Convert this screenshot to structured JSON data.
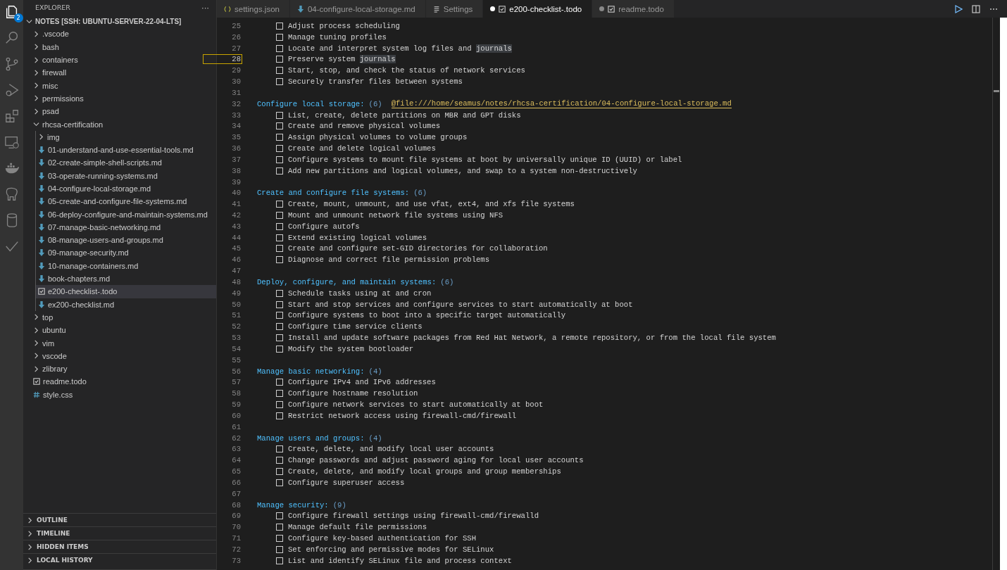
{
  "activity_bar": {
    "badge": "2"
  },
  "explorer": {
    "title": "EXPLORER",
    "more": "···",
    "root": "NOTES [SSH: UBUNTU-SERVER-22-04-LTS]",
    "tree": [
      {
        "name": ".vscode",
        "kind": "folder",
        "expanded": false,
        "selected": false
      },
      {
        "name": "bash",
        "kind": "folder",
        "expanded": false,
        "selected": false
      },
      {
        "name": "containers",
        "kind": "folder",
        "expanded": false,
        "selected": false
      },
      {
        "name": "firewall",
        "kind": "folder",
        "expanded": false,
        "selected": false
      },
      {
        "name": "misc",
        "kind": "folder",
        "expanded": false,
        "selected": false
      },
      {
        "name": "permissions",
        "kind": "folder",
        "expanded": false,
        "selected": false
      },
      {
        "name": "psad",
        "kind": "folder",
        "expanded": false,
        "selected": false
      },
      {
        "name": "rhcsa-certification",
        "kind": "folder",
        "expanded": true,
        "selected": false,
        "children": [
          {
            "name": "img",
            "kind": "folder",
            "expanded": false,
            "selected": false
          },
          {
            "name": "01-understand-and-use-essential-tools.md",
            "kind": "md",
            "selected": false
          },
          {
            "name": "02-create-simple-shell-scripts.md",
            "kind": "md",
            "selected": false
          },
          {
            "name": "03-operate-running-systems.md",
            "kind": "md",
            "selected": false
          },
          {
            "name": "04-configure-local-storage.md",
            "kind": "md",
            "selected": false
          },
          {
            "name": "05-create-and-configure-file-systems.md",
            "kind": "md",
            "selected": false
          },
          {
            "name": "06-deploy-configure-and-maintain-systems.md",
            "kind": "md",
            "selected": false
          },
          {
            "name": "07-manage-basic-networking.md",
            "kind": "md",
            "selected": false
          },
          {
            "name": "08-manage-users-and-groups.md",
            "kind": "md",
            "selected": false
          },
          {
            "name": "09-manage-security.md",
            "kind": "md",
            "selected": false
          },
          {
            "name": "10-manage-containers.md",
            "kind": "md",
            "selected": false
          },
          {
            "name": "book-chapters.md",
            "kind": "md",
            "selected": false
          },
          {
            "name": "e200-checklist-.todo",
            "kind": "todo",
            "selected": true
          },
          {
            "name": "ex200-checklist.md",
            "kind": "md",
            "selected": false
          }
        ]
      },
      {
        "name": "top",
        "kind": "folder",
        "expanded": false,
        "selected": false
      },
      {
        "name": "ubuntu",
        "kind": "folder",
        "expanded": false,
        "selected": false
      },
      {
        "name": "vim",
        "kind": "folder",
        "expanded": false,
        "selected": false
      },
      {
        "name": "vscode",
        "kind": "folder",
        "expanded": false,
        "selected": false
      },
      {
        "name": "zlibrary",
        "kind": "folder",
        "expanded": false,
        "selected": false
      },
      {
        "name": "readme.todo",
        "kind": "todo",
        "selected": false
      },
      {
        "name": "style.css",
        "kind": "css",
        "selected": false
      }
    ],
    "sections": [
      "OUTLINE",
      "TIMELINE",
      "HIDDEN ITEMS",
      "LOCAL HISTORY"
    ]
  },
  "tabs": [
    {
      "label": "settings.json",
      "kind": "json",
      "selected": false,
      "dirty": false
    },
    {
      "label": "04-configure-local-storage.md",
      "kind": "md",
      "selected": false,
      "dirty": false
    },
    {
      "label": "Settings",
      "kind": "settings",
      "selected": false,
      "dirty": false
    },
    {
      "label": "e200-checklist-.todo",
      "kind": "todo",
      "selected": true,
      "dirty": true
    },
    {
      "label": "readme.todo",
      "kind": "todo",
      "selected": false,
      "dirty": true
    }
  ],
  "editor": {
    "lines": [
      {
        "n": "25",
        "kind": "task",
        "current": false,
        "parts": [
          {
            "text": "Adjust process scheduling",
            "highlighted": false
          }
        ]
      },
      {
        "n": "26",
        "kind": "task",
        "current": false,
        "parts": [
          {
            "text": "Manage tuning profiles",
            "highlighted": false
          }
        ]
      },
      {
        "n": "27",
        "kind": "task",
        "current": false,
        "parts": [
          {
            "text": "Locate and interpret system log files and ",
            "highlighted": false
          },
          {
            "text": "journals",
            "highlighted": true
          }
        ]
      },
      {
        "n": "28",
        "kind": "task",
        "current": true,
        "parts": [
          {
            "text": "Preserve system ",
            "highlighted": false
          },
          {
            "text": "journals",
            "highlighted": true
          }
        ]
      },
      {
        "n": "29",
        "kind": "task",
        "current": false,
        "parts": [
          {
            "text": "Start, stop, and check the status of network services",
            "highlighted": false
          }
        ]
      },
      {
        "n": "30",
        "kind": "task",
        "current": false,
        "parts": [
          {
            "text": "Securely transfer files between systems",
            "highlighted": false
          }
        ]
      },
      {
        "n": "31",
        "kind": "blank",
        "current": false
      },
      {
        "n": "32",
        "kind": "header",
        "current": false,
        "title": "Configure local storage:",
        "count": "(6)",
        "link": "@file:///home/seamus/notes/rhcsa-certification/04-configure-local-storage.md"
      },
      {
        "n": "33",
        "kind": "task",
        "current": false,
        "parts": [
          {
            "text": "List, create, delete partitions on MBR and GPT disks",
            "highlighted": false
          }
        ]
      },
      {
        "n": "34",
        "kind": "task",
        "current": false,
        "parts": [
          {
            "text": "Create and remove physical volumes",
            "highlighted": false
          }
        ]
      },
      {
        "n": "35",
        "kind": "task",
        "current": false,
        "parts": [
          {
            "text": "Assign physical volumes to volume groups",
            "highlighted": false
          }
        ]
      },
      {
        "n": "36",
        "kind": "task",
        "current": false,
        "parts": [
          {
            "text": "Create and delete logical volumes",
            "highlighted": false
          }
        ]
      },
      {
        "n": "37",
        "kind": "task",
        "current": false,
        "parts": [
          {
            "text": "Configure systems to mount file systems at boot by universally unique ID (UUID) or label",
            "highlighted": false
          }
        ]
      },
      {
        "n": "38",
        "kind": "task",
        "current": false,
        "parts": [
          {
            "text": "Add new partitions and logical volumes, and swap to a system non-destructively",
            "highlighted": false
          }
        ]
      },
      {
        "n": "39",
        "kind": "blank",
        "current": false
      },
      {
        "n": "40",
        "kind": "header",
        "current": false,
        "title": "Create and configure file systems:",
        "count": "(6)"
      },
      {
        "n": "41",
        "kind": "task",
        "current": false,
        "parts": [
          {
            "text": "Create, mount, unmount, and use vfat, ext4, and xfs file systems",
            "highlighted": false
          }
        ]
      },
      {
        "n": "42",
        "kind": "task",
        "current": false,
        "parts": [
          {
            "text": "Mount and unmount network file systems using NFS",
            "highlighted": false
          }
        ]
      },
      {
        "n": "43",
        "kind": "task",
        "current": false,
        "parts": [
          {
            "text": "Configure autofs",
            "highlighted": false
          }
        ]
      },
      {
        "n": "44",
        "kind": "task",
        "current": false,
        "parts": [
          {
            "text": "Extend existing logical volumes",
            "highlighted": false
          }
        ]
      },
      {
        "n": "45",
        "kind": "task",
        "current": false,
        "parts": [
          {
            "text": "Create and configure set-GID directories for collaboration",
            "highlighted": false
          }
        ]
      },
      {
        "n": "46",
        "kind": "task",
        "current": false,
        "parts": [
          {
            "text": "Diagnose and correct file permission problems",
            "highlighted": false
          }
        ]
      },
      {
        "n": "47",
        "kind": "blank",
        "current": false
      },
      {
        "n": "48",
        "kind": "header",
        "current": false,
        "title": "Deploy, configure, and maintain systems:",
        "count": "(6)"
      },
      {
        "n": "49",
        "kind": "task",
        "current": false,
        "parts": [
          {
            "text": "Schedule tasks using at and cron",
            "highlighted": false
          }
        ]
      },
      {
        "n": "50",
        "kind": "task",
        "current": false,
        "parts": [
          {
            "text": "Start and stop services and configure services to start automatically at boot",
            "highlighted": false
          }
        ]
      },
      {
        "n": "51",
        "kind": "task",
        "current": false,
        "parts": [
          {
            "text": "Configure systems to boot into a specific target automatically",
            "highlighted": false
          }
        ]
      },
      {
        "n": "52",
        "kind": "task",
        "current": false,
        "parts": [
          {
            "text": "Configure time service clients",
            "highlighted": false
          }
        ]
      },
      {
        "n": "53",
        "kind": "task",
        "current": false,
        "parts": [
          {
            "text": "Install and update software packages from Red Hat Network, a remote repository, or from the local file system",
            "highlighted": false
          }
        ]
      },
      {
        "n": "54",
        "kind": "task",
        "current": false,
        "parts": [
          {
            "text": "Modify the system bootloader",
            "highlighted": false
          }
        ]
      },
      {
        "n": "55",
        "kind": "blank",
        "current": false
      },
      {
        "n": "56",
        "kind": "header",
        "current": false,
        "title": "Manage basic networking:",
        "count": "(4)"
      },
      {
        "n": "57",
        "kind": "task",
        "current": false,
        "parts": [
          {
            "text": "Configure IPv4 and IPv6 addresses",
            "highlighted": false
          }
        ]
      },
      {
        "n": "58",
        "kind": "task",
        "current": false,
        "parts": [
          {
            "text": "Configure hostname resolution",
            "highlighted": false
          }
        ]
      },
      {
        "n": "59",
        "kind": "task",
        "current": false,
        "parts": [
          {
            "text": "Configure network services to start automatically at boot",
            "highlighted": false
          }
        ]
      },
      {
        "n": "60",
        "kind": "task",
        "current": false,
        "parts": [
          {
            "text": "Restrict network access using firewall-cmd/firewall",
            "highlighted": false
          }
        ]
      },
      {
        "n": "61",
        "kind": "blank",
        "current": false
      },
      {
        "n": "62",
        "kind": "header",
        "current": false,
        "title": "Manage users and groups:",
        "count": "(4)"
      },
      {
        "n": "63",
        "kind": "task",
        "current": false,
        "parts": [
          {
            "text": "Create, delete, and modify local user accounts",
            "highlighted": false
          }
        ]
      },
      {
        "n": "64",
        "kind": "task",
        "current": false,
        "parts": [
          {
            "text": "Change passwords and adjust password aging for local user accounts",
            "highlighted": false
          }
        ]
      },
      {
        "n": "65",
        "kind": "task",
        "current": false,
        "parts": [
          {
            "text": "Create, delete, and modify local groups and group memberships",
            "highlighted": false
          }
        ]
      },
      {
        "n": "66",
        "kind": "task",
        "current": false,
        "parts": [
          {
            "text": "Configure superuser access",
            "highlighted": false
          }
        ]
      },
      {
        "n": "67",
        "kind": "blank",
        "current": false
      },
      {
        "n": "68",
        "kind": "header",
        "current": false,
        "title": "Manage security:",
        "count": "(9)"
      },
      {
        "n": "69",
        "kind": "task",
        "current": false,
        "parts": [
          {
            "text": "Configure firewall settings using firewall-cmd/firewalld",
            "highlighted": false
          }
        ]
      },
      {
        "n": "70",
        "kind": "task",
        "current": false,
        "parts": [
          {
            "text": "Manage default file permissions",
            "highlighted": false
          }
        ]
      },
      {
        "n": "71",
        "kind": "task",
        "current": false,
        "parts": [
          {
            "text": "Configure key-based authentication for SSH",
            "highlighted": false
          }
        ]
      },
      {
        "n": "72",
        "kind": "task",
        "current": false,
        "parts": [
          {
            "text": "Set enforcing and permissive modes for SELinux",
            "highlighted": false
          }
        ]
      },
      {
        "n": "73",
        "kind": "task",
        "current": false,
        "parts": [
          {
            "text": "List and identify SELinux file and process context",
            "highlighted": false
          }
        ]
      }
    ]
  }
}
